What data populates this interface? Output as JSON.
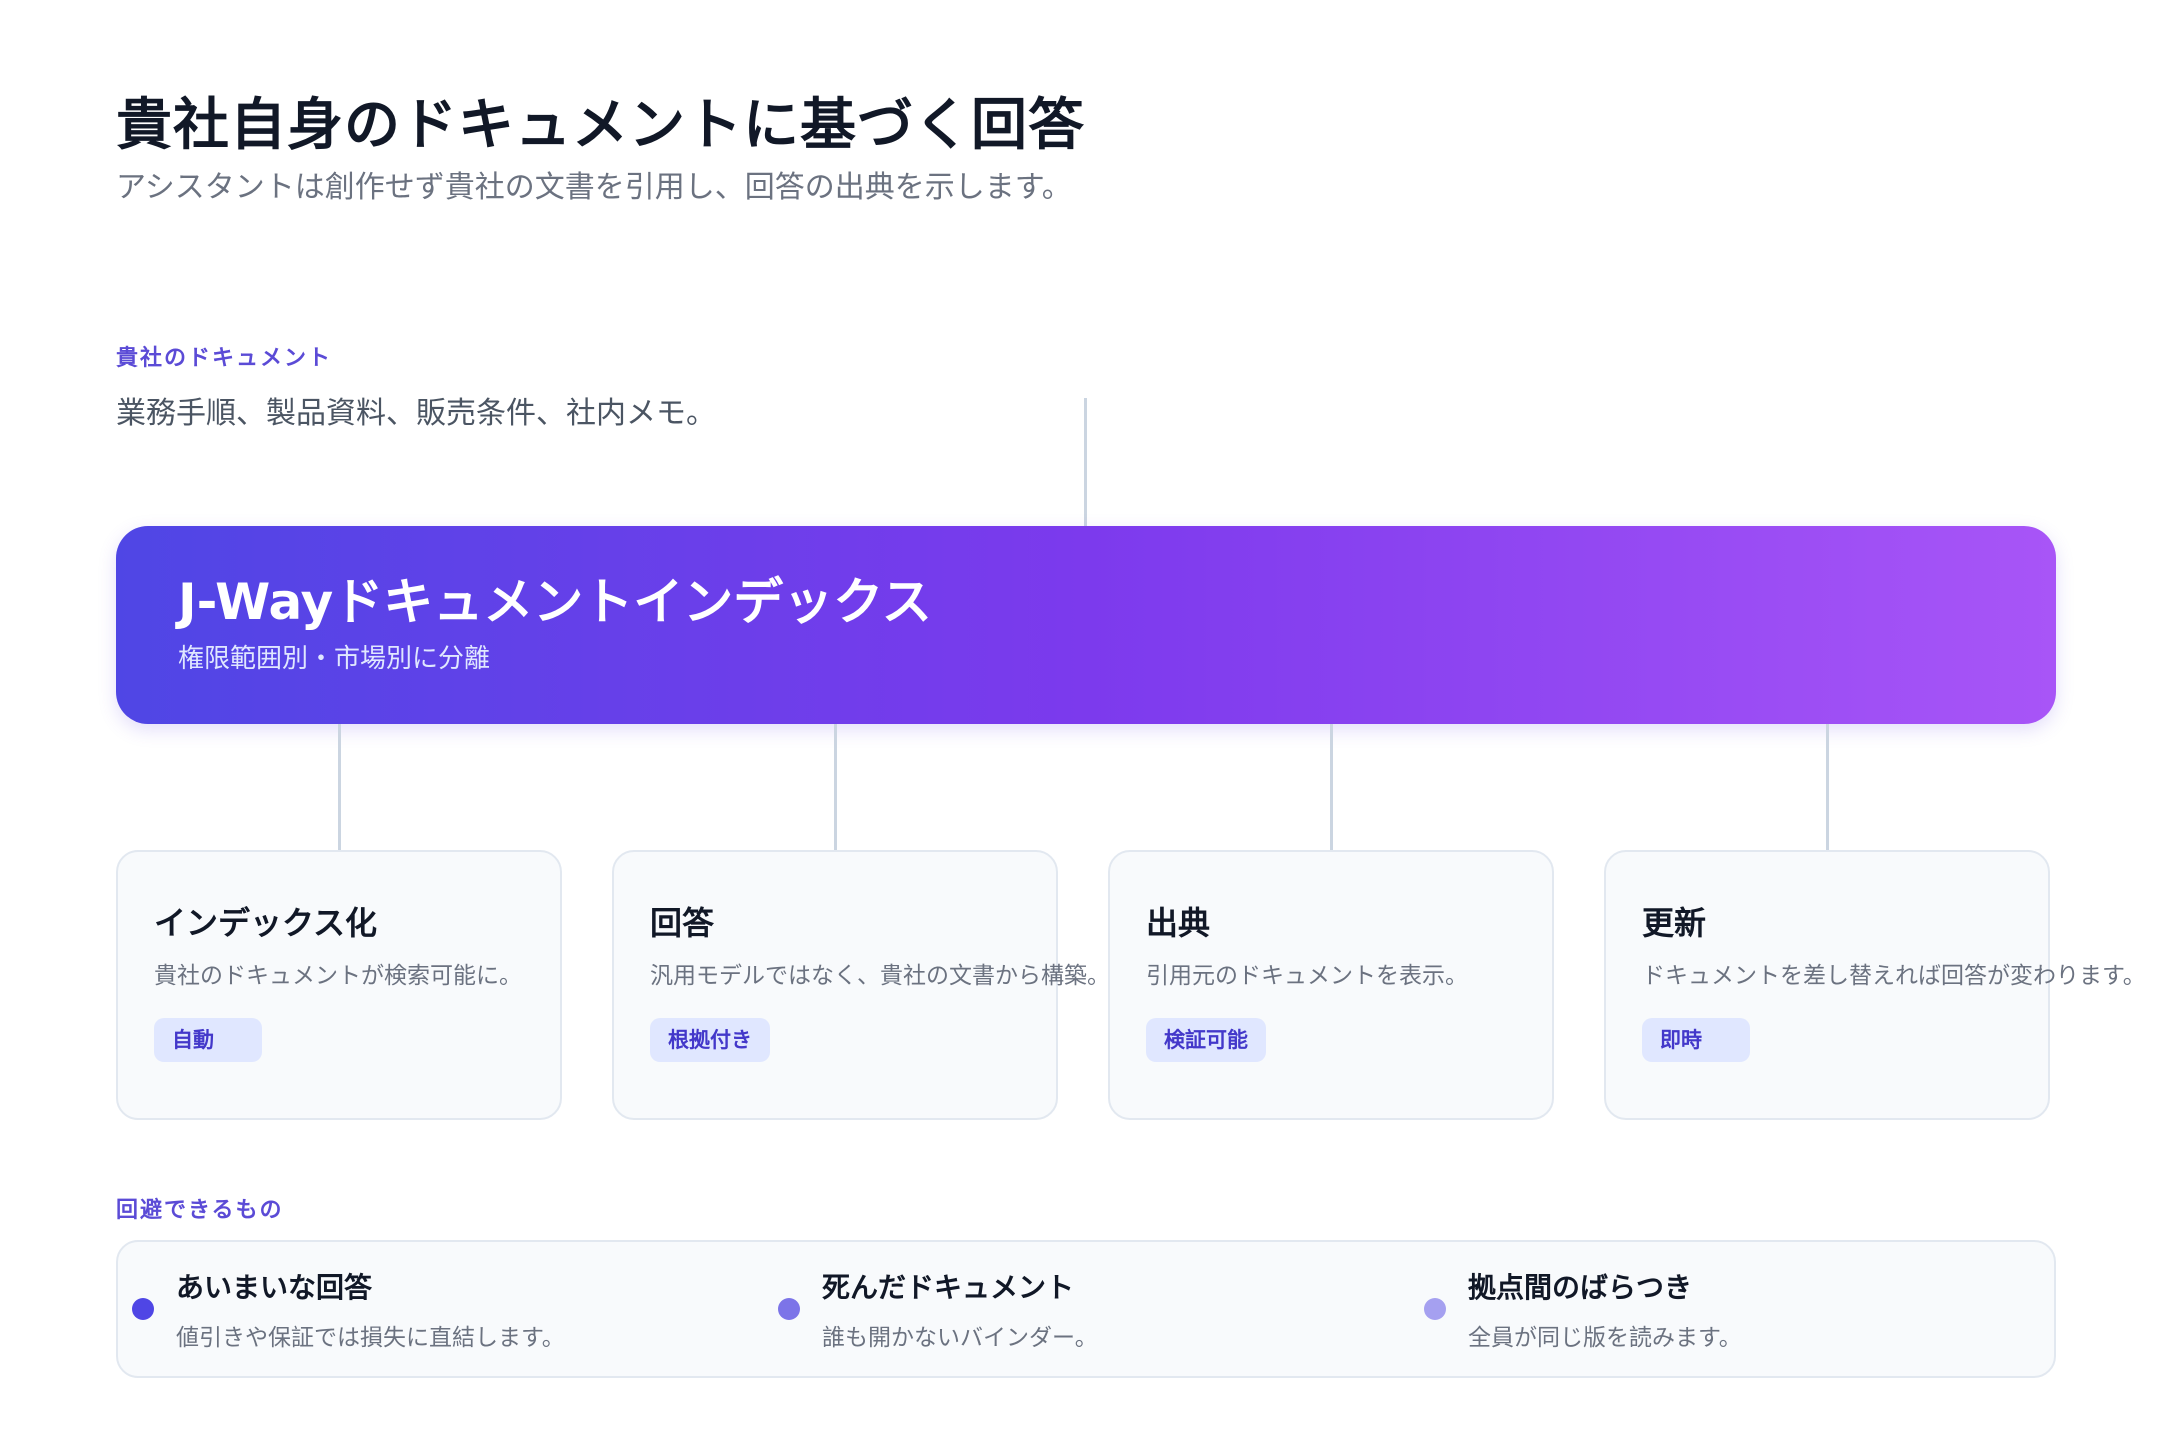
{
  "header": {
    "title": "貴社自身のドキュメントに基づく回答",
    "subtitle": "アシスタントは創作せず貴社の文書を引用し、回答の出典を示します。"
  },
  "source": {
    "label": "貴社のドキュメント",
    "description": "業務手順、製品資料、販売条件、社内メモ。"
  },
  "index": {
    "title": "J-Wayドキュメントインデックス",
    "subtitle": "権限範囲別・市場別に分離"
  },
  "cards": [
    {
      "title": "インデックス化",
      "description": "貴社のドキュメントが検索可能に。",
      "badge": "自動"
    },
    {
      "title": "回答",
      "description": "汎用モデルではなく、貴社の文書から構築。",
      "badge": "根拠付き"
    },
    {
      "title": "出典",
      "description": "引用元のドキュメントを表示。",
      "badge": "検証可能"
    },
    {
      "title": "更新",
      "description": "ドキュメントを差し替えれば回答が変わります。",
      "badge": "即時"
    }
  ],
  "avoid": {
    "label": "回避できるもの",
    "items": [
      {
        "title": "あいまいな回答",
        "description": "値引きや保証では損失に直結します。",
        "dot_color": "#4f46e5"
      },
      {
        "title": "死んだドキュメント",
        "description": "誰も開かないバインダー。",
        "dot_color": "#7c74e8"
      },
      {
        "title": "拠点間のばらつき",
        "description": "全員が同じ版を読みます。",
        "dot_color": "#a5a0f0"
      }
    ]
  },
  "colors": {
    "accent": "#5b4bd6",
    "gradient_start": "#4f46e5",
    "gradient_end": "#a855f7"
  }
}
